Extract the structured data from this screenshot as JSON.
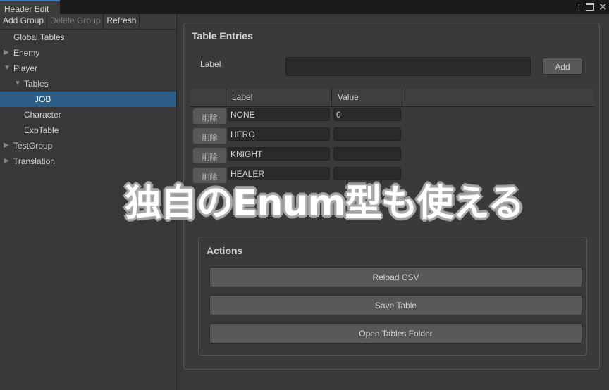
{
  "window": {
    "tab_title": "Header Edit"
  },
  "toolbar": {
    "add_group": "Add Group",
    "delete_group": "Delete Group",
    "refresh": "Refresh"
  },
  "tree": [
    {
      "label": "Global Tables",
      "arrow": ""
    },
    {
      "label": "Enemy",
      "arrow": "▶"
    },
    {
      "label": "Player",
      "arrow": "▼"
    },
    {
      "label": "Tables",
      "arrow": "▼"
    },
    {
      "label": "JOB",
      "arrow": ""
    },
    {
      "label": "Character",
      "arrow": ""
    },
    {
      "label": "ExpTable",
      "arrow": ""
    },
    {
      "label": "TestGroup",
      "arrow": "▶"
    },
    {
      "label": "Translation",
      "arrow": "▶"
    }
  ],
  "entries": {
    "title": "Table Entries",
    "label_caption": "Label",
    "label_value": "",
    "add": "Add",
    "col_label": "Label",
    "col_value": "Value",
    "delete": "削除",
    "rows": [
      {
        "label": "NONE",
        "value": "0"
      },
      {
        "label": "HERO",
        "value": ""
      },
      {
        "label": "KNIGHT",
        "value": ""
      },
      {
        "label": "HEALER",
        "value": ""
      }
    ]
  },
  "actions": {
    "title": "Actions",
    "reload": "Reload CSV",
    "save": "Save Table",
    "open": "Open Tables Folder"
  },
  "overlay": "独自のEnum型も使える"
}
